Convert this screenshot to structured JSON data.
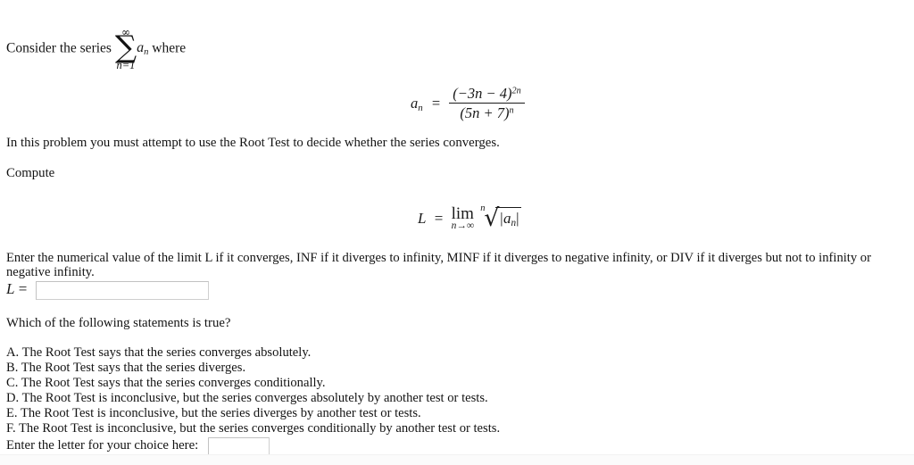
{
  "problem": {
    "intro_prefix": "Consider the series",
    "intro_suffix": "where",
    "series": {
      "sum_upper": "∞",
      "sum_symbol": "∑",
      "sum_lower": "n=1",
      "term_base": "a",
      "term_sub": "n"
    },
    "an_definition": {
      "lhs_base": "a",
      "lhs_sub": "n",
      "equals": "=",
      "numerator_text": "(−3n − 4)",
      "numerator_exponent": "2n",
      "denominator_text": "(5n + 7)",
      "denominator_exponent": "n"
    },
    "root_test_statement": "In this problem you must attempt to use the Root Test to decide whether the series converges.",
    "compute_label": "Compute",
    "limit_definition": {
      "lhs": "L",
      "equals": "=",
      "operator": "lim",
      "operator_under": "n→∞",
      "root_index": "n",
      "radical_symbol": "√",
      "radicand": "|a",
      "radicand_sub": "n",
      "radicand_close": "|"
    },
    "limit_instructions": "Enter the numerical value of the limit L if it converges, INF if it diverges to infinity, MINF if it diverges to negative infinity, or DIV if it diverges but not to infinity or negative infinity.",
    "limit_field": {
      "label_var": "L",
      "label_equals": "=",
      "value": "",
      "placeholder": ""
    },
    "choice_prompt": "Which of the following statements is true?",
    "choices": [
      "A. The Root Test says that the series converges absolutely.",
      "B. The Root Test says that the series diverges.",
      "C. The Root Test says that the series converges conditionally.",
      "D. The Root Test is inconclusive, but the series converges absolutely by another test or tests.",
      "E. The Root Test is inconclusive, but the series diverges by another test or tests.",
      "F. The Root Test is inconclusive, but the series converges conditionally by another test or tests."
    ],
    "letter_field": {
      "label": "Enter the letter for your choice here:",
      "value": "",
      "placeholder": ""
    }
  },
  "colors": {
    "text": "#131313",
    "math": "#1a1a1a",
    "field_border": "#cfcfcf",
    "background": "#ffffff"
  }
}
